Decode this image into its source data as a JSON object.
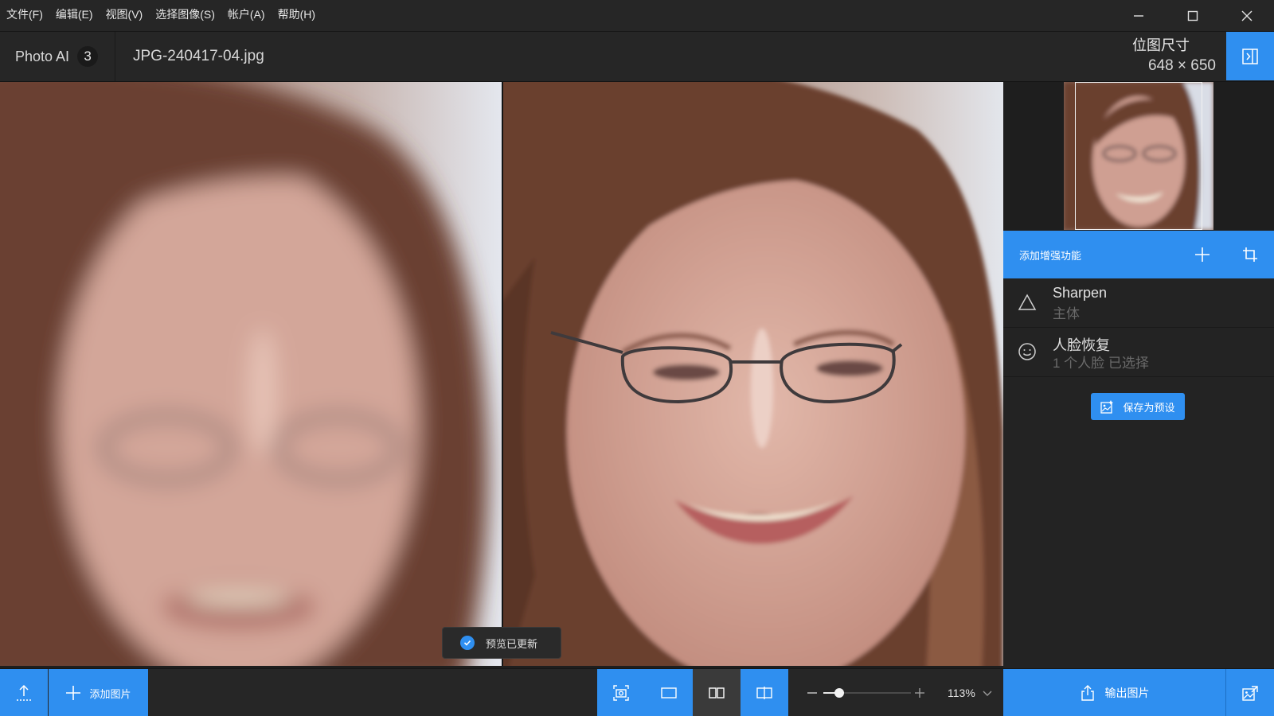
{
  "menubar": {
    "items": [
      {
        "label": "文件(F)"
      },
      {
        "label": "编辑(E)"
      },
      {
        "label": "视图(V)"
      },
      {
        "label": "选择图像(S)"
      },
      {
        "label": "帐户(A)"
      },
      {
        "label": "帮助(H)"
      }
    ]
  },
  "header": {
    "app_name": "Photo AI",
    "image_count": "3",
    "file_name": "JPG-240417-04.jpg",
    "size_label": "位图尺寸",
    "size_value": "648 × 650"
  },
  "viewer": {
    "toast": "预览已更新"
  },
  "panel": {
    "enhancements_title": "添加增强功能",
    "enhancements": [
      {
        "name": "Sharpen",
        "sub": "主体",
        "icon": "triangle-icon"
      },
      {
        "name": "人脸恢复",
        "sub": "1 个人脸  已选择",
        "icon": "face-icon"
      }
    ],
    "save_preset": "保存为预设"
  },
  "bottombar": {
    "add_images": "添加图片",
    "zoom_level": "113%",
    "zoom_fraction": 0.18,
    "export": "输出图片",
    "active_view": "split-view"
  },
  "colors": {
    "accent": "#2f8ff0",
    "background": "#1e1e1e",
    "panel": "#262626"
  }
}
